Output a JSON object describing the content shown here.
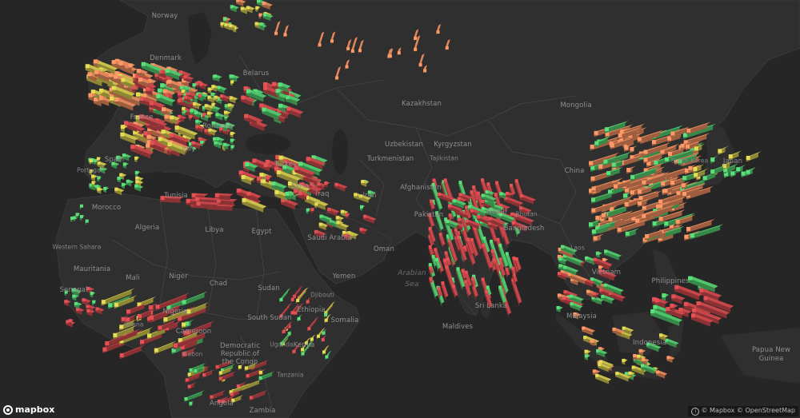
{
  "map": {
    "colors": {
      "water": "#262626",
      "land": "#2f2f2f",
      "border": "#4a4a4a",
      "red": "#c8464a",
      "orange": "#e2865a",
      "yellow": "#c9c04a",
      "green": "#4fc46a"
    },
    "countries": [
      "Norway",
      "Denmark",
      "Belarus",
      "Kazakhstan",
      "Mongolia",
      "France",
      "Romania",
      "Uzbekistan",
      "Kyrgyzstan",
      "Spain",
      "Portugal",
      "Italy",
      "Turkey",
      "Turkmenistan",
      "Tajikistan",
      "China",
      "South Korea",
      "Japan",
      "Tunisia",
      "Syria",
      "Iraq",
      "Iran",
      "Afghanistan",
      "Morocco",
      "Pakistan",
      "Nepal",
      "Bhutan",
      "Bangladesh",
      "Algeria",
      "Libya",
      "Egypt",
      "Saudi Arabia",
      "Oman",
      "Western Sahara",
      "Mauritania",
      "Mali",
      "Niger",
      "Chad",
      "Sudan",
      "Yemen",
      "Senegal",
      "Nigeria",
      "Djibouti",
      "Ethiopia",
      "Somalia",
      "South Sudan",
      "Ghana",
      "Cameroon",
      "Laos",
      "Vietnam",
      "Philippines",
      "Sri Lanka",
      "Malaysia",
      "Maldives",
      "Gabon",
      "Uganda",
      "Kenya",
      "Democratic Republic of the Congo",
      "Tanzania",
      "Indonesia",
      "Papua New Guinea",
      "Angola",
      "Zambia"
    ],
    "water_labels": [
      "Arabian Sea"
    ]
  },
  "branding": {
    "logo": "mapbox",
    "attribution": "© Mapbox © OpenStreetMap"
  }
}
